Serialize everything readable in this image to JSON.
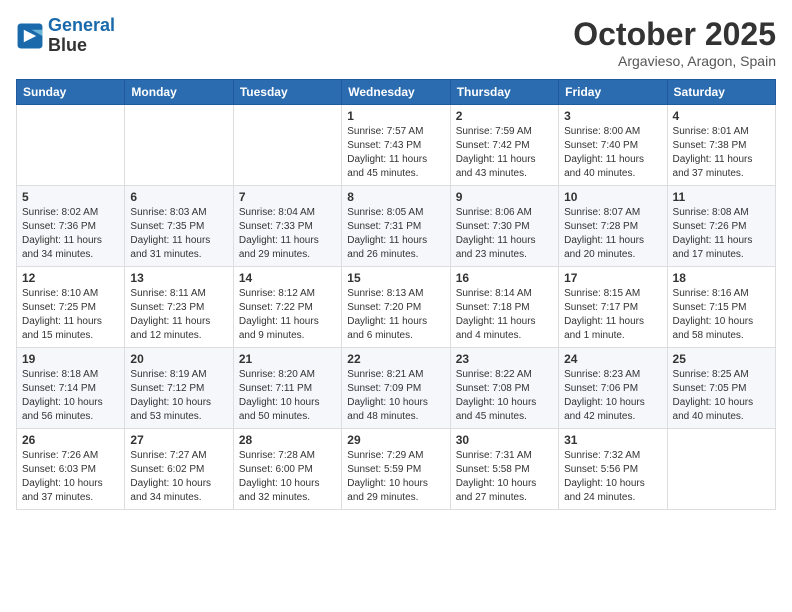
{
  "header": {
    "logo_line1": "General",
    "logo_line2": "Blue",
    "month": "October 2025",
    "location": "Argavieso, Aragon, Spain"
  },
  "weekdays": [
    "Sunday",
    "Monday",
    "Tuesday",
    "Wednesday",
    "Thursday",
    "Friday",
    "Saturday"
  ],
  "weeks": [
    [
      {
        "day": "",
        "info": ""
      },
      {
        "day": "",
        "info": ""
      },
      {
        "day": "",
        "info": ""
      },
      {
        "day": "1",
        "info": "Sunrise: 7:57 AM\nSunset: 7:43 PM\nDaylight: 11 hours\nand 45 minutes."
      },
      {
        "day": "2",
        "info": "Sunrise: 7:59 AM\nSunset: 7:42 PM\nDaylight: 11 hours\nand 43 minutes."
      },
      {
        "day": "3",
        "info": "Sunrise: 8:00 AM\nSunset: 7:40 PM\nDaylight: 11 hours\nand 40 minutes."
      },
      {
        "day": "4",
        "info": "Sunrise: 8:01 AM\nSunset: 7:38 PM\nDaylight: 11 hours\nand 37 minutes."
      }
    ],
    [
      {
        "day": "5",
        "info": "Sunrise: 8:02 AM\nSunset: 7:36 PM\nDaylight: 11 hours\nand 34 minutes."
      },
      {
        "day": "6",
        "info": "Sunrise: 8:03 AM\nSunset: 7:35 PM\nDaylight: 11 hours\nand 31 minutes."
      },
      {
        "day": "7",
        "info": "Sunrise: 8:04 AM\nSunset: 7:33 PM\nDaylight: 11 hours\nand 29 minutes."
      },
      {
        "day": "8",
        "info": "Sunrise: 8:05 AM\nSunset: 7:31 PM\nDaylight: 11 hours\nand 26 minutes."
      },
      {
        "day": "9",
        "info": "Sunrise: 8:06 AM\nSunset: 7:30 PM\nDaylight: 11 hours\nand 23 minutes."
      },
      {
        "day": "10",
        "info": "Sunrise: 8:07 AM\nSunset: 7:28 PM\nDaylight: 11 hours\nand 20 minutes."
      },
      {
        "day": "11",
        "info": "Sunrise: 8:08 AM\nSunset: 7:26 PM\nDaylight: 11 hours\nand 17 minutes."
      }
    ],
    [
      {
        "day": "12",
        "info": "Sunrise: 8:10 AM\nSunset: 7:25 PM\nDaylight: 11 hours\nand 15 minutes."
      },
      {
        "day": "13",
        "info": "Sunrise: 8:11 AM\nSunset: 7:23 PM\nDaylight: 11 hours\nand 12 minutes."
      },
      {
        "day": "14",
        "info": "Sunrise: 8:12 AM\nSunset: 7:22 PM\nDaylight: 11 hours\nand 9 minutes."
      },
      {
        "day": "15",
        "info": "Sunrise: 8:13 AM\nSunset: 7:20 PM\nDaylight: 11 hours\nand 6 minutes."
      },
      {
        "day": "16",
        "info": "Sunrise: 8:14 AM\nSunset: 7:18 PM\nDaylight: 11 hours\nand 4 minutes."
      },
      {
        "day": "17",
        "info": "Sunrise: 8:15 AM\nSunset: 7:17 PM\nDaylight: 11 hours\nand 1 minute."
      },
      {
        "day": "18",
        "info": "Sunrise: 8:16 AM\nSunset: 7:15 PM\nDaylight: 10 hours\nand 58 minutes."
      }
    ],
    [
      {
        "day": "19",
        "info": "Sunrise: 8:18 AM\nSunset: 7:14 PM\nDaylight: 10 hours\nand 56 minutes."
      },
      {
        "day": "20",
        "info": "Sunrise: 8:19 AM\nSunset: 7:12 PM\nDaylight: 10 hours\nand 53 minutes."
      },
      {
        "day": "21",
        "info": "Sunrise: 8:20 AM\nSunset: 7:11 PM\nDaylight: 10 hours\nand 50 minutes."
      },
      {
        "day": "22",
        "info": "Sunrise: 8:21 AM\nSunset: 7:09 PM\nDaylight: 10 hours\nand 48 minutes."
      },
      {
        "day": "23",
        "info": "Sunrise: 8:22 AM\nSunset: 7:08 PM\nDaylight: 10 hours\nand 45 minutes."
      },
      {
        "day": "24",
        "info": "Sunrise: 8:23 AM\nSunset: 7:06 PM\nDaylight: 10 hours\nand 42 minutes."
      },
      {
        "day": "25",
        "info": "Sunrise: 8:25 AM\nSunset: 7:05 PM\nDaylight: 10 hours\nand 40 minutes."
      }
    ],
    [
      {
        "day": "26",
        "info": "Sunrise: 7:26 AM\nSunset: 6:03 PM\nDaylight: 10 hours\nand 37 minutes."
      },
      {
        "day": "27",
        "info": "Sunrise: 7:27 AM\nSunset: 6:02 PM\nDaylight: 10 hours\nand 34 minutes."
      },
      {
        "day": "28",
        "info": "Sunrise: 7:28 AM\nSunset: 6:00 PM\nDaylight: 10 hours\nand 32 minutes."
      },
      {
        "day": "29",
        "info": "Sunrise: 7:29 AM\nSunset: 5:59 PM\nDaylight: 10 hours\nand 29 minutes."
      },
      {
        "day": "30",
        "info": "Sunrise: 7:31 AM\nSunset: 5:58 PM\nDaylight: 10 hours\nand 27 minutes."
      },
      {
        "day": "31",
        "info": "Sunrise: 7:32 AM\nSunset: 5:56 PM\nDaylight: 10 hours\nand 24 minutes."
      },
      {
        "day": "",
        "info": ""
      }
    ]
  ]
}
